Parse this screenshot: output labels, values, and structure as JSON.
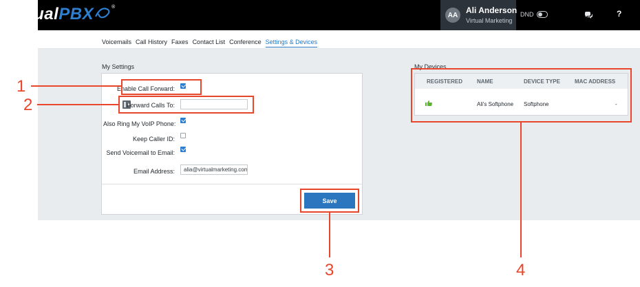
{
  "header": {
    "logo_virtual": "Virtual",
    "logo_pbx": "PBX",
    "logo_tm": "®",
    "avatar_initials": "AA",
    "user_name": "Ali Anderson",
    "user_org": "Virtual Marketing",
    "dnd_label": "DND",
    "help_label": "?"
  },
  "nav": {
    "tabs": [
      {
        "label": "Voicemails"
      },
      {
        "label": "Call History"
      },
      {
        "label": "Faxes"
      },
      {
        "label": "Contact List"
      },
      {
        "label": "Conference"
      },
      {
        "label": "Settings & Devices",
        "active": true
      }
    ]
  },
  "settings": {
    "section_title": "My Settings",
    "enable_forward_label": "Enable Call Forward:",
    "enable_forward_checked": true,
    "forward_to_label": "Forward Calls To:",
    "forward_to_value": "",
    "ring_voip_label": "Also Ring My VoIP Phone:",
    "ring_voip_checked": true,
    "keep_caller_id_label": "Keep Caller ID:",
    "keep_caller_id_checked": false,
    "send_vm_label": "Send Voicemail to Email:",
    "send_vm_checked": true,
    "email_label": "Email Address:",
    "email_value": "alia@virtualmarketing.com",
    "save_label": "Save"
  },
  "devices": {
    "section_title": "My Devices",
    "columns": [
      "REGISTERED",
      "NAME",
      "DEVICE TYPE",
      "MAC ADDRESS"
    ],
    "rows": [
      {
        "registered_icon": "thumbs-up-icon",
        "name": "Ali's Softphone",
        "type": "Softphone",
        "mac": "-"
      }
    ]
  },
  "annotations": {
    "n1": "1",
    "n2": "2",
    "n3": "3",
    "n4": "4"
  },
  "colors": {
    "accent": "#2e7fd0",
    "annotation": "#e8452a",
    "registered": "#5cb32e"
  }
}
